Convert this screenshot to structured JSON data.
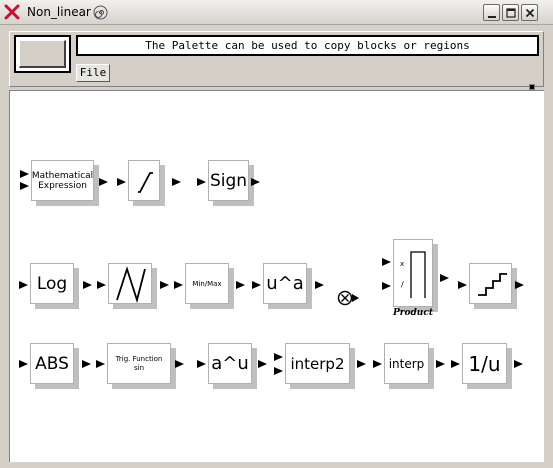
{
  "window": {
    "title": "Non_linear",
    "buttons": [
      "minimize-icon",
      "maximize-icon",
      "close-icon"
    ]
  },
  "header": {
    "message": "The Palette can be used to copy blocks or regions",
    "file_menu": "File"
  },
  "blocks": {
    "math_expr": {
      "line1": "Mathematical",
      "line2": "Expression"
    },
    "saturation": {
      "icon": "saturation-icon"
    },
    "sign": {
      "label": "Sign"
    },
    "log": {
      "label": "Log"
    },
    "sawtooth": {
      "icon": "sawtooth-icon"
    },
    "minmax": {
      "label": "Min/Max"
    },
    "pow_ua": {
      "label": "u^a"
    },
    "product": {
      "label": "Product",
      "times_sign": "x",
      "div_sign": "/"
    },
    "quantizer": {
      "icon": "staircase-icon"
    },
    "abs": {
      "label": "ABS"
    },
    "trig": {
      "line1": "Trig. Function",
      "line2": "sin"
    },
    "pow_au": {
      "label": "a^u"
    },
    "interp2": {
      "label": "interp2"
    },
    "interp": {
      "label": "interp"
    },
    "inverse": {
      "label": "1/u"
    }
  }
}
